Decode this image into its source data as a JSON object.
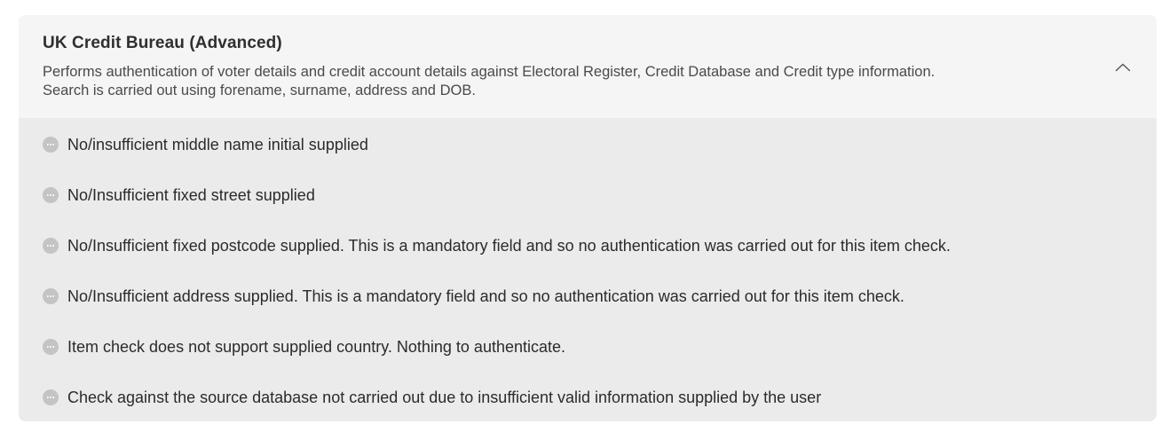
{
  "panel": {
    "title": "UK Credit Bureau (Advanced)",
    "description_line1": "Performs authentication of voter details and credit account details against Electoral Register, Credit Database and Credit type information.",
    "description_line2": "Search is carried out using forename, surname, address and DOB.",
    "toggle_icon": "chevron-up-icon",
    "expanded": true
  },
  "results": [
    {
      "status_icon": "neutral-dots-icon",
      "text": "No/insufficient middle name initial supplied"
    },
    {
      "status_icon": "neutral-dots-icon",
      "text": "No/Insufficient fixed street supplied"
    },
    {
      "status_icon": "neutral-dots-icon",
      "text": "No/Insufficient fixed postcode supplied. This is a mandatory field and so no authentication was carried out for this item check."
    },
    {
      "status_icon": "neutral-dots-icon",
      "text": "No/Insufficient address supplied. This is a mandatory field and so no authentication was carried out for this item check."
    },
    {
      "status_icon": "neutral-dots-icon",
      "text": "Item check does not support supplied country. Nothing to authenticate."
    },
    {
      "status_icon": "neutral-dots-icon",
      "text": "Check against the source database not carried out due to insufficient valid information supplied by the user"
    }
  ],
  "colors": {
    "header_bg": "#f5f5f5",
    "body_bg": "#ebebeb",
    "status_icon_fill": "#c4c4c4",
    "status_icon_dots": "#ffffff"
  }
}
